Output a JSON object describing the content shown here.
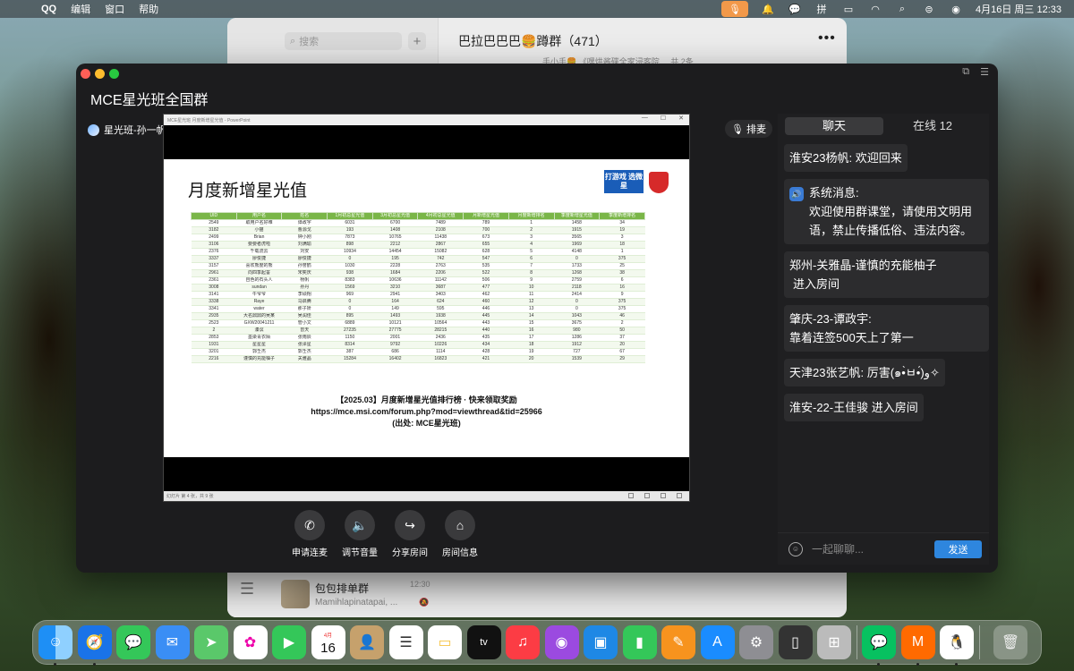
{
  "menubar": {
    "app": "QQ",
    "items": [
      "编辑",
      "窗口",
      "帮助"
    ],
    "datetime": "4月16日 周三  12:33"
  },
  "bg_window": {
    "search_placeholder": "搜索",
    "group_title": "巴拉巴巴巴🍔蹲群（471）",
    "peek_text": "手小手🍔 《嘿烘酱碟全家浸客院 ...  共 2条",
    "chat_name": "包包排单群",
    "chat_preview": "Mamihlapinatapai, ...",
    "chat_time": "12:30"
  },
  "room": {
    "title": "MCE星光班全国群",
    "presenter": "星光班-孙一帆",
    "follow_label": "关注",
    "queue_label": "排麦"
  },
  "ppt": {
    "titlebar": "MCE星光班 月度新增星光值 - PowerPoint",
    "status": "幻灯片 第 4 张，共 9 张",
    "slide_title": "月度新增星光值",
    "logo_text": "打游戏 选微星",
    "table_headers": [
      "UID",
      "用户名",
      "姓名",
      "1月初总星光值",
      "3月初总星光值",
      "4月初总星光值",
      "月新增星光值",
      "月度新增排名",
      "季度新增星光值",
      "季度新增排名"
    ],
    "rows": [
      [
        "2549",
        "取用户名好难",
        "谭政宇",
        "6031",
        "6700",
        "7489",
        "789",
        "1",
        "1458",
        "34"
      ],
      [
        "3182",
        "小猫",
        "曹源戈",
        "193",
        "1408",
        "2108",
        "700",
        "2",
        "1915",
        "19"
      ],
      [
        "2499",
        "Brian",
        "钟小刚",
        "7873",
        "10765",
        "11438",
        "673",
        "3",
        "3565",
        "3"
      ],
      [
        "3106",
        "要要者虎啦",
        "刘满瑜",
        "898",
        "2212",
        "2867",
        "655",
        "4",
        "1969",
        "18"
      ],
      [
        "2376",
        "千载流云",
        "刘安",
        "10934",
        "14454",
        "15082",
        "628",
        "5",
        "4148",
        "1"
      ],
      [
        "3337",
        "廖俊捷",
        "廖俊捷",
        "0",
        "195",
        "742",
        "547",
        "6",
        "0",
        "375"
      ],
      [
        "3157",
        "喜欢熊度的熊",
        "孙誉鹤",
        "1030",
        "2228",
        "2763",
        "535",
        "7",
        "1733",
        "25"
      ],
      [
        "2961",
        "向四季起誓",
        "宋奕庆",
        "938",
        "1684",
        "2206",
        "522",
        "8",
        "1268",
        "38"
      ],
      [
        "2361",
        "自色的石头人",
        "杨帆",
        "8383",
        "10636",
        "11142",
        "506",
        "9",
        "2759",
        "6"
      ],
      [
        "3008",
        "sundan",
        "孙丹",
        "1569",
        "3210",
        "3687",
        "477",
        "10",
        "2118",
        "16"
      ],
      [
        "3141",
        "牛爷爷",
        "李硕翔",
        "969",
        "2941",
        "3403",
        "462",
        "11",
        "2414",
        "9"
      ],
      [
        "3338",
        "Raye",
        "马启腾",
        "0",
        "164",
        "624",
        "460",
        "12",
        "0",
        "375"
      ],
      [
        "3341",
        "water",
        "那子妍",
        "0",
        "149",
        "595",
        "446",
        "13",
        "0",
        "375"
      ],
      [
        "2935",
        "大名鼎鼎的吴某",
        "吴润佳",
        "895",
        "1493",
        "1938",
        "445",
        "14",
        "1043",
        "46"
      ],
      [
        "2523",
        "GXW20041211",
        "管小文",
        "6889",
        "10121",
        "10564",
        "443",
        "15",
        "3675",
        "2"
      ],
      [
        "2",
        "溱溟",
        "曾天",
        "27235",
        "27775",
        "28215",
        "440",
        "16",
        "980",
        "50"
      ],
      [
        "2853",
        "墨染青衣陌",
        "张雨辰",
        "1150",
        "2001",
        "2436",
        "435",
        "17",
        "1286",
        "37"
      ],
      [
        "1931",
        "星星星",
        "张泽星",
        "8314",
        "9792",
        "10226",
        "434",
        "18",
        "1912",
        "20"
      ],
      [
        "3201",
        "郭壬杰",
        "郭壬杰",
        "387",
        "686",
        "1114",
        "428",
        "19",
        "727",
        "67"
      ],
      [
        "2216",
        "谨慎的充能柚子",
        "关雅晶",
        "15284",
        "16402",
        "16823",
        "421",
        "20",
        "1539",
        "29"
      ]
    ],
    "caption": [
      "【2025.03】月度新增星光值排行榜 · 快来领取奖励",
      "https://mce.msi.com/forum.php?mod=viewthread&tid=25966",
      "(出处: MCE星光班)"
    ]
  },
  "controls": [
    "申请连麦",
    "调节音量",
    "分享房间",
    "房间信息"
  ],
  "chat": {
    "tab_chat": "聊天",
    "tab_online": "在线 12",
    "messages": [
      {
        "who": "淮安23杨帆:",
        "text": " 欢迎回来"
      },
      {
        "who": "系统消息:",
        "text": "欢迎使用群课堂，请使用文明用语，禁止传播低俗、违法内容。"
      },
      {
        "who": "郑州-关雅晶-谨慎的充能柚子",
        "text": "进入房间"
      },
      {
        "who": "肇庆-23-谭政宇:",
        "text": "靠着连签500天上了第一"
      },
      {
        "who": "天津23张艺帆:",
        "text": " 厉害(๑•̀ㅂ•́)و✧"
      },
      {
        "who": "淮安-22-王佳骏",
        "text": " 进入房间"
      }
    ],
    "input_placeholder": "一起聊聊...",
    "send_label": "发送"
  },
  "dock": {
    "calendar_month": "4月",
    "calendar_day": "16"
  }
}
